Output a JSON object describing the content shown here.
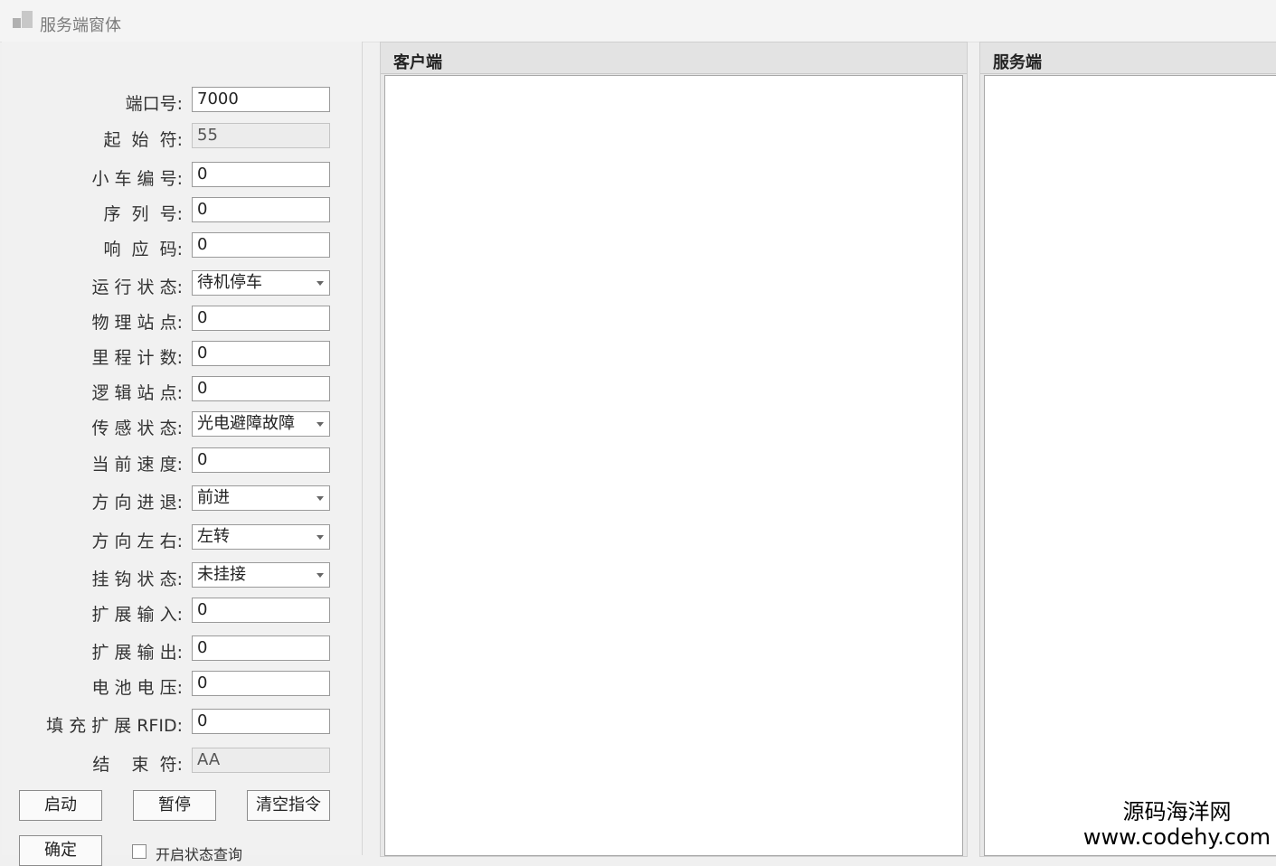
{
  "window": {
    "title": "服务端窗体"
  },
  "fields": [
    {
      "label": "端口号:",
      "value": "7000",
      "readonly": false,
      "combo": false
    },
    {
      "label": "起  始  符:",
      "value": "55",
      "readonly": true,
      "combo": false
    },
    {
      "label": "小 车 编 号:",
      "value": "0",
      "readonly": false,
      "combo": false
    },
    {
      "label": "序  列  号:",
      "value": "0",
      "readonly": false,
      "combo": false
    },
    {
      "label": "响  应  码:",
      "value": "0",
      "readonly": false,
      "combo": false
    },
    {
      "label": "运 行 状 态:",
      "value": "待机停车",
      "readonly": false,
      "combo": true
    },
    {
      "label": "物 理 站 点:",
      "value": "0",
      "readonly": false,
      "combo": false
    },
    {
      "label": "里 程 计 数:",
      "value": "0",
      "readonly": false,
      "combo": false
    },
    {
      "label": "逻 辑 站 点:",
      "value": "0",
      "readonly": false,
      "combo": false
    },
    {
      "label": "传 感 状 态:",
      "value": "光电避障故障",
      "readonly": false,
      "combo": true
    },
    {
      "label": "当 前 速 度:",
      "value": "0",
      "readonly": false,
      "combo": false
    },
    {
      "label": "方 向 进 退:",
      "value": "前进",
      "readonly": false,
      "combo": true
    },
    {
      "label": "方 向 左 右:",
      "value": "左转",
      "readonly": false,
      "combo": true
    },
    {
      "label": "挂 钩 状 态:",
      "value": "未挂接",
      "readonly": false,
      "combo": true
    },
    {
      "label": "扩 展 输 入:",
      "value": "0",
      "readonly": false,
      "combo": false
    },
    {
      "label": "扩 展 输 出:",
      "value": "0",
      "readonly": false,
      "combo": false
    },
    {
      "label": "电 池 电 压:",
      "value": "0",
      "readonly": false,
      "combo": false
    },
    {
      "label": "填 充 扩 展 RFID:",
      "value": "0",
      "readonly": false,
      "combo": false
    },
    {
      "label": "结    束  符:",
      "value": "AA",
      "readonly": true,
      "combo": false
    }
  ],
  "buttons": {
    "start": "启动",
    "pause": "暂停",
    "clear": "清空指令",
    "confirm": "确定"
  },
  "checkbox": {
    "label": "开启状态查询"
  },
  "panels": {
    "client": "客户端",
    "server": "服务端"
  },
  "watermark": {
    "line1": "源码海洋网",
    "line2": "www.codehy.com"
  }
}
